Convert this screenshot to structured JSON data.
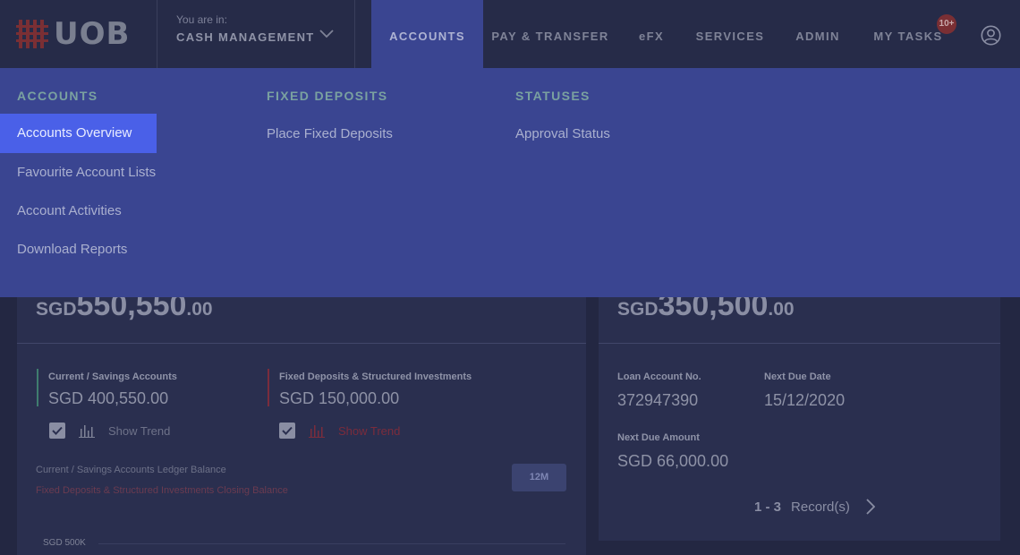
{
  "brand": {
    "logo_text": "UOB"
  },
  "header": {
    "context_label": "You are in:",
    "context_value": "CASH MANAGEMENT",
    "nav": [
      "ACCOUNTS",
      "PAY & TRANSFER",
      "eFX",
      "SERVICES",
      "ADMIN",
      "MY TASKS"
    ],
    "tasks_badge": "10+"
  },
  "mega_menu": {
    "accounts": {
      "heading": "ACCOUNTS",
      "items": [
        "Accounts Overview",
        "Favourite Account Lists",
        "Account Activities",
        "Download Reports"
      ]
    },
    "fixed_deposits": {
      "heading": "FIXED DEPOSITS",
      "items": [
        "Place Fixed Deposits"
      ]
    },
    "statuses": {
      "heading": "STATUSES",
      "items": [
        "Approval Status"
      ]
    }
  },
  "left_card": {
    "currency": "SGD",
    "amount_main": "550,550",
    "amount_dec": ".00",
    "current": {
      "label": "Current / Savings Accounts",
      "value": "SGD 400,550.00",
      "trend_label": "Show Trend"
    },
    "fixed": {
      "label": "Fixed Deposits & Structured Investments",
      "value": "SGD 150,000.00",
      "trend_label": "Show Trend"
    },
    "legend_current": "Current / Savings Accounts Ledger Balance",
    "legend_fixed": "Fixed Deposits & Structured  Investments Closing Balance",
    "period_button": "12M",
    "axis_label": "SGD 500K"
  },
  "right_card": {
    "currency": "SGD",
    "amount_main": "350,500",
    "amount_dec": ".00",
    "loan_no_label": "Loan Account No.",
    "loan_no_value": "372947390",
    "due_date_label": "Next Due Date",
    "due_date_value": "15/12/2020",
    "due_amount_label": "Next Due Amount",
    "due_amount_value": "SGD 66,000.00",
    "pager_range": "1 - 3",
    "pager_label": "Record(s)"
  },
  "colors": {
    "accent_current": "#3f7c6e",
    "accent_fixed": "#7b2c3c",
    "menu_bg": "#3a4591",
    "menu_selected": "#4a60e8"
  }
}
